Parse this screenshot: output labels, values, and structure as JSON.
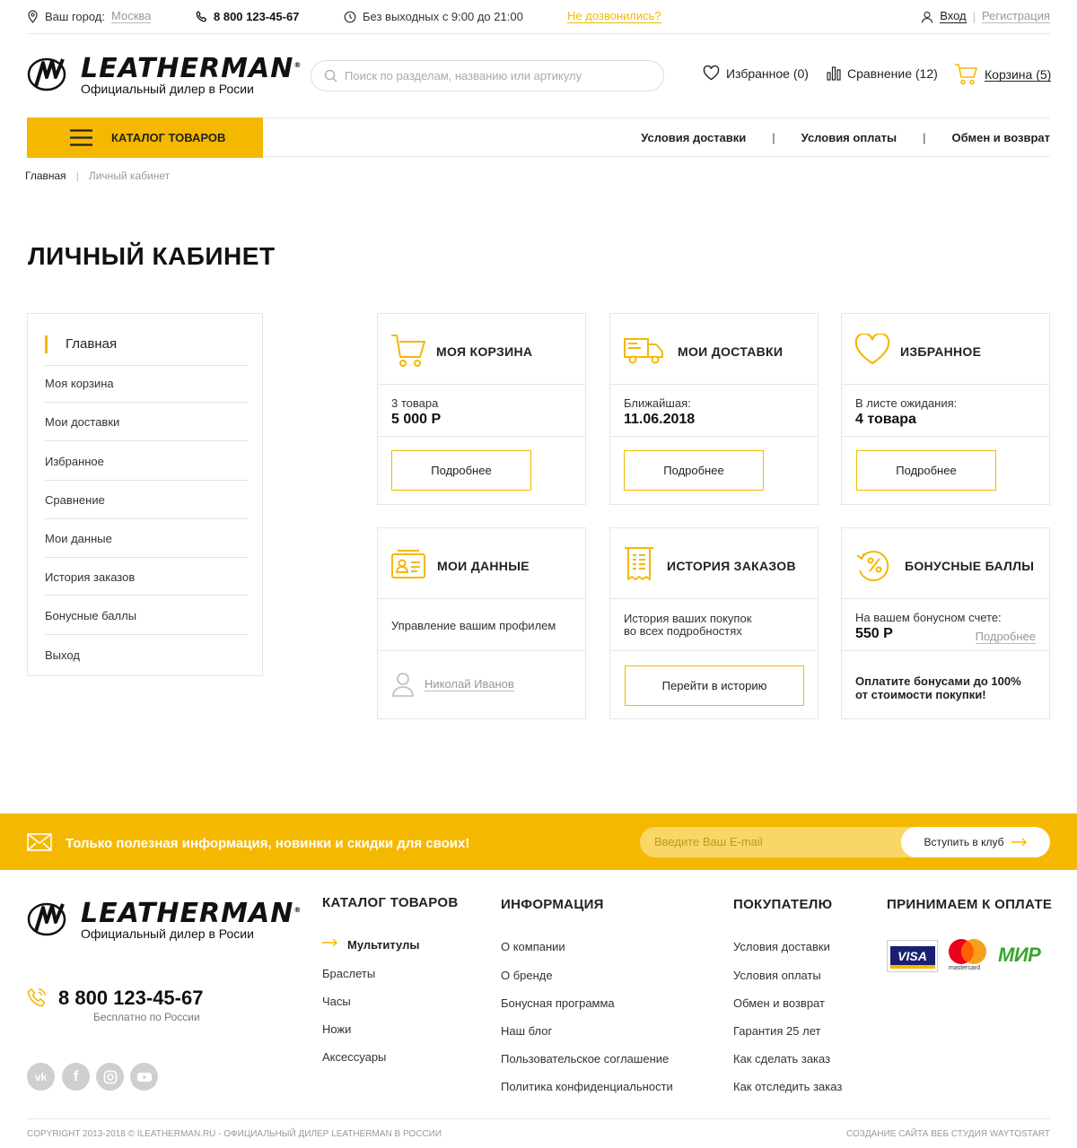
{
  "topbar": {
    "city_label": "Ваш город:",
    "city_value": "Москва",
    "phone": "8 800 123-45-67",
    "hours": "Без выходных с 9:00 до 21:00",
    "callback": "Не дозвонились?",
    "login": "Вход",
    "sep": "|",
    "register": "Регистрация"
  },
  "logo": {
    "word": "LEATHERMAN",
    "mark": "®",
    "sub": "Официальный дилер в Росии"
  },
  "search": {
    "placeholder": "Поиск по разделам, названию или артикулу"
  },
  "header": {
    "favorites": "Избранное (0)",
    "compare": "Сравнение (12)",
    "cart": "Корзина (5)"
  },
  "nav": {
    "catalog": "КАТАЛОГ ТОВАРОВ",
    "links": [
      "Условия доставки",
      "Условия оплаты",
      "Обмен и возврат"
    ],
    "sep": "|"
  },
  "breadcrumb": {
    "home": "Главная",
    "sep": "|",
    "current": "Личный кабинет"
  },
  "page_title": "ЛИЧНЫЙ КАБИНЕТ",
  "sidebar": {
    "active": "Главная",
    "items": [
      "Моя корзина",
      "Мои доставки",
      "Избранное",
      "Сравнение",
      "Мои данные",
      "История заказов",
      "Бонусные баллы",
      "Выход"
    ]
  },
  "cards": {
    "cart": {
      "title": "МОЯ КОРЗИНА",
      "label": "3 товара",
      "value": "5 000 Р",
      "button": "Подробнее"
    },
    "delivery": {
      "title": "МОИ ДОСТАВКИ",
      "label": "Ближайшая:",
      "value": "11.06.2018",
      "button": "Подробнее"
    },
    "favorites": {
      "title": "ИЗБРАННОЕ",
      "label": "В листе ожидания:",
      "value": "4 товара",
      "button": "Подробнее"
    },
    "profile": {
      "title": "МОИ ДАННЫЕ",
      "text": "Управление вашим профилем",
      "user": "Николай Иванов"
    },
    "history": {
      "title": "ИСТОРИЯ ЗАКАЗОВ",
      "text_line1": "История ваших покупок",
      "text_line2": "во всех подробностях",
      "button": "Перейти в историю"
    },
    "bonus": {
      "title": "БОНУСНЫЕ БАЛЛЫ",
      "label": "На вашем бонусном счете:",
      "value": "550 Р",
      "more": "Подробнее",
      "note_line1": "Оплатите бонусами до 100%",
      "note_line2": "от стоимости покупки!"
    }
  },
  "subscribe": {
    "text": "Только полезная информация, новинки и скидки для своих!",
    "placeholder": "Введите Ваш E-mail",
    "button": "Вступить в клуб"
  },
  "footer": {
    "phone": "8 800 123-45-67",
    "phone_note": "Бесплатно по России",
    "catalog": {
      "title": "КАТАЛОГ ТОВАРОВ",
      "items": [
        "Мультитулы",
        "Браслеты",
        "Часы",
        "Ножи",
        "Аксессуары"
      ]
    },
    "info": {
      "title": "ИНФОРМАЦИЯ",
      "items": [
        "О компании",
        "О бренде",
        "Бонусная программа",
        "Наш блог",
        "Пользовательское соглашение",
        "Политика конфиденциальности"
      ]
    },
    "buyer": {
      "title": "ПОКУПАТЕЛЮ",
      "items": [
        "Условия доставки",
        "Условия оплаты",
        "Обмен и возврат",
        "Гарантия 25 лет",
        "Как сделать заказ",
        "Как отследить заказ"
      ]
    },
    "payment": {
      "title": "ПРИНИМАЕМ К ОПЛАТЕ",
      "visa": "VISA",
      "mastercard": "mastercard",
      "mir": "МИР"
    },
    "social": [
      "vk-icon",
      "facebook-icon",
      "instagram-icon",
      "youtube-icon"
    ],
    "copyright": "COPYRIGHT 2013-2018 © ILEATHERMAN.RU - ОФИЦИАЛЬНЫЙ ДИЛЕР LEATHERMAN В РОССИИ",
    "studio": "СОЗДАНИЕ САЙТА ВЕБ СТУДИЯ WAYTOSTART"
  },
  "colors": {
    "accent": "#f5b800",
    "text": "#222222",
    "muted": "#999999",
    "border": "#e6e6e6"
  }
}
